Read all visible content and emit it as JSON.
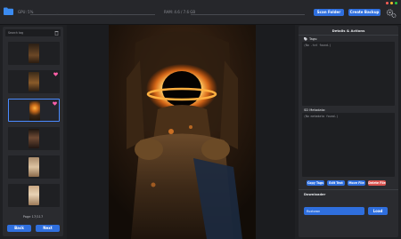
{
  "topbar": {
    "gpu_label": "GPU: 5%",
    "ram_label": "RAM: 4.6 / 7.6 GB",
    "scan_label": "Scan Folder",
    "create_label": "Create Backup",
    "accent": "#2f6fde"
  },
  "sidebar": {
    "search_placeholder": "Search tag",
    "page_label": "Page 17/117",
    "back_label": "Back",
    "next_label": "Next",
    "thumbnails": [
      {
        "favorite": false,
        "selected": false
      },
      {
        "favorite": true,
        "selected": false
      },
      {
        "favorite": true,
        "selected": true
      },
      {
        "favorite": false,
        "selected": false
      },
      {
        "favorite": false,
        "selected": false
      },
      {
        "favorite": false,
        "selected": false
      }
    ]
  },
  "panel": {
    "title": "Details & Actions",
    "tags_heading": "Tags:",
    "tags_text": "(No .txt found.)",
    "sd_heading": "SD Metadata:",
    "sd_text": "(No metadata found.)",
    "copy_label": "Copy Tags",
    "edit_label": "Edit Text",
    "move_label": "Move File",
    "delete_label": "Delete File",
    "delete_color": "#d9534f",
    "downloader_heading": "Downloader",
    "downloader_value": "fluxtoron",
    "load_label": "Load"
  }
}
